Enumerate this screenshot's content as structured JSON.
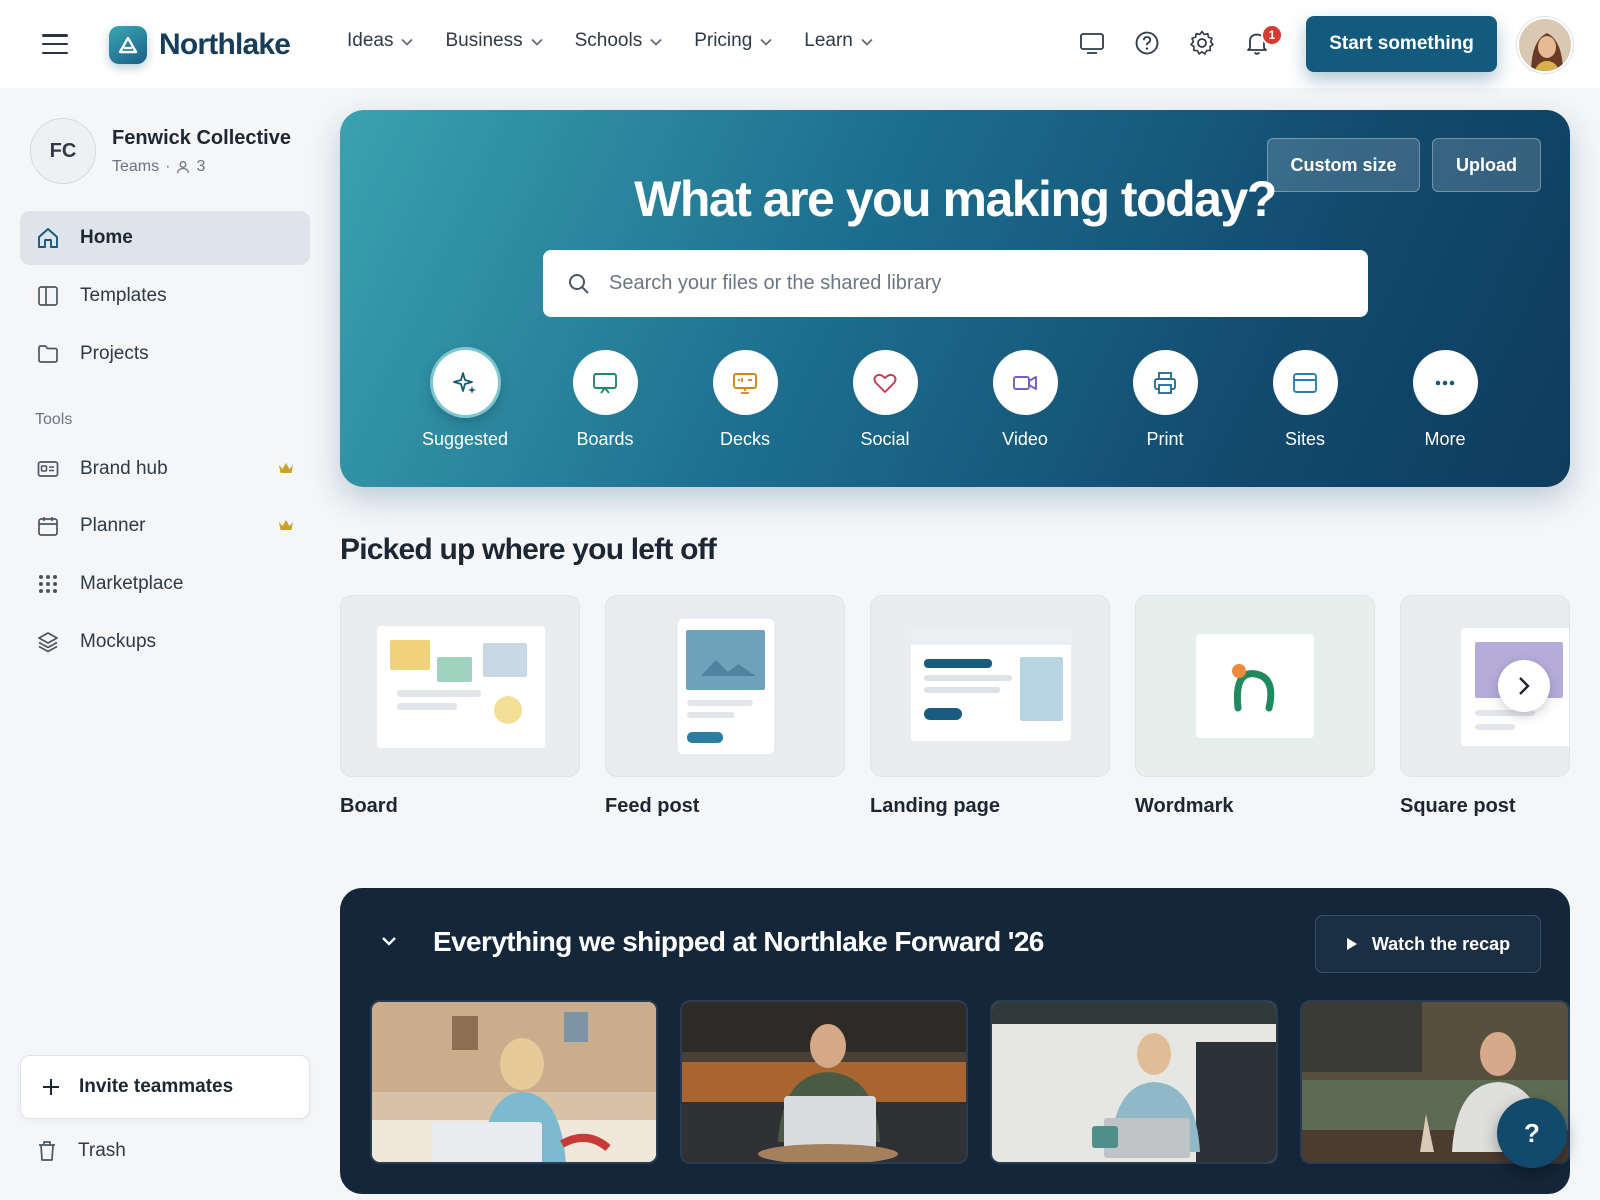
{
  "header": {
    "brand": "Northlake",
    "nav": [
      "Ideas",
      "Business",
      "Schools",
      "Pricing",
      "Learn"
    ],
    "notification_count": "1",
    "start_label": "Start something"
  },
  "sidebar": {
    "team_initials": "FC",
    "team_name": "Fenwick Collective",
    "team_type": "Teams",
    "member_count": "3",
    "items": [
      {
        "label": "Home",
        "icon": "home-icon"
      },
      {
        "label": "Templates",
        "icon": "templates-icon"
      },
      {
        "label": "Projects",
        "icon": "folder-icon"
      }
    ],
    "tools_heading": "Tools",
    "tools": [
      {
        "label": "Brand hub",
        "icon": "id-card-icon",
        "premium": true
      },
      {
        "label": "Planner",
        "icon": "calendar-icon",
        "premium": true
      },
      {
        "label": "Marketplace",
        "icon": "grid-dots-icon",
        "premium": false
      },
      {
        "label": "Mockups",
        "icon": "layers-icon",
        "premium": false
      }
    ],
    "invite_label": "Invite teammates",
    "trash_label": "Trash"
  },
  "hero": {
    "title": "What are you making today?",
    "custom_size": "Custom size",
    "upload": "Upload",
    "search_placeholder": "Search your files or the shared library",
    "categories": [
      "Suggested",
      "Boards",
      "Decks",
      "Social",
      "Video",
      "Print",
      "Sites",
      "More"
    ]
  },
  "recent": {
    "title": "Picked up where you left off",
    "items": [
      "Board",
      "Feed post",
      "Landing page",
      "Wordmark",
      "Square post"
    ]
  },
  "event": {
    "title": "Everything we shipped at Northlake Forward '26",
    "watch_label": "Watch the recap"
  },
  "help_label": "?",
  "colors": {
    "brand": "#135b7d",
    "hero_start": "#3aa2b0",
    "hero_end": "#0e3c5d",
    "event_bg": "#14263a",
    "badge": "#d63a30",
    "premium": "#c9a227"
  }
}
